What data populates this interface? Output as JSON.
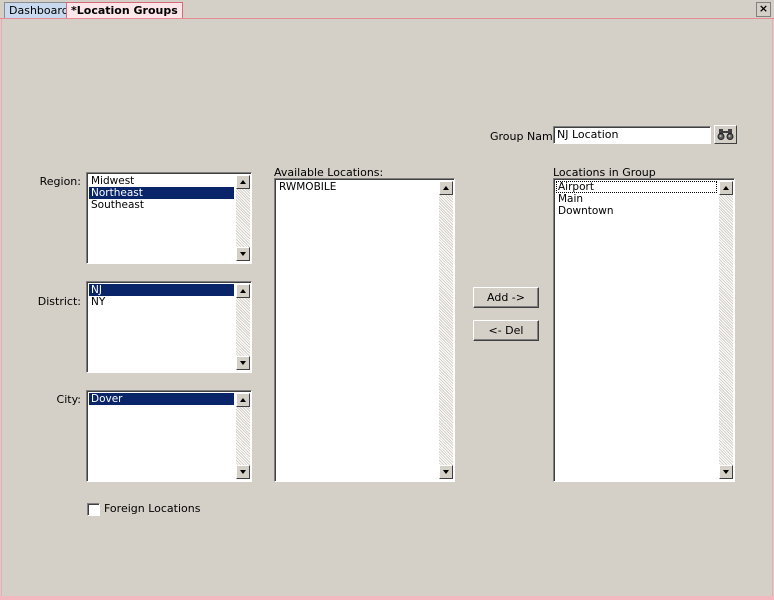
{
  "tabs": [
    {
      "label": "Dashboard"
    },
    {
      "label": "*Location Groups"
    }
  ],
  "close_label": "×",
  "group_name": {
    "label": "Group Name:",
    "value": "NJ Location"
  },
  "region": {
    "label": "Region:",
    "items": [
      "Midwest",
      "Northeast",
      "Southeast"
    ],
    "selected": "Northeast"
  },
  "district": {
    "label": "District:",
    "items": [
      "NJ",
      "NY"
    ],
    "selected": "NJ"
  },
  "city": {
    "label": "City:",
    "items": [
      "Dover"
    ],
    "selected": "Dover"
  },
  "available_locations": {
    "label": "Available Locations:",
    "items": [
      "RWMOBILE"
    ]
  },
  "locations_in_group": {
    "label": "Locations in Group",
    "items": [
      "Airport",
      "Main",
      "Downtown"
    ],
    "focused": "Airport"
  },
  "buttons": {
    "add": "Add ->",
    "del": "<- Del"
  },
  "foreign_locations": {
    "label": "Foreign Locations",
    "checked": false
  },
  "icons": {
    "find": "binoculars-icon",
    "close": "close-icon",
    "checkbox": "checkbox-icon"
  },
  "colors": {
    "selection": "#0a246a",
    "active_tab": "#fde6e9",
    "inactive_tab": "#c9daf0",
    "window": "#d4d0c8"
  }
}
